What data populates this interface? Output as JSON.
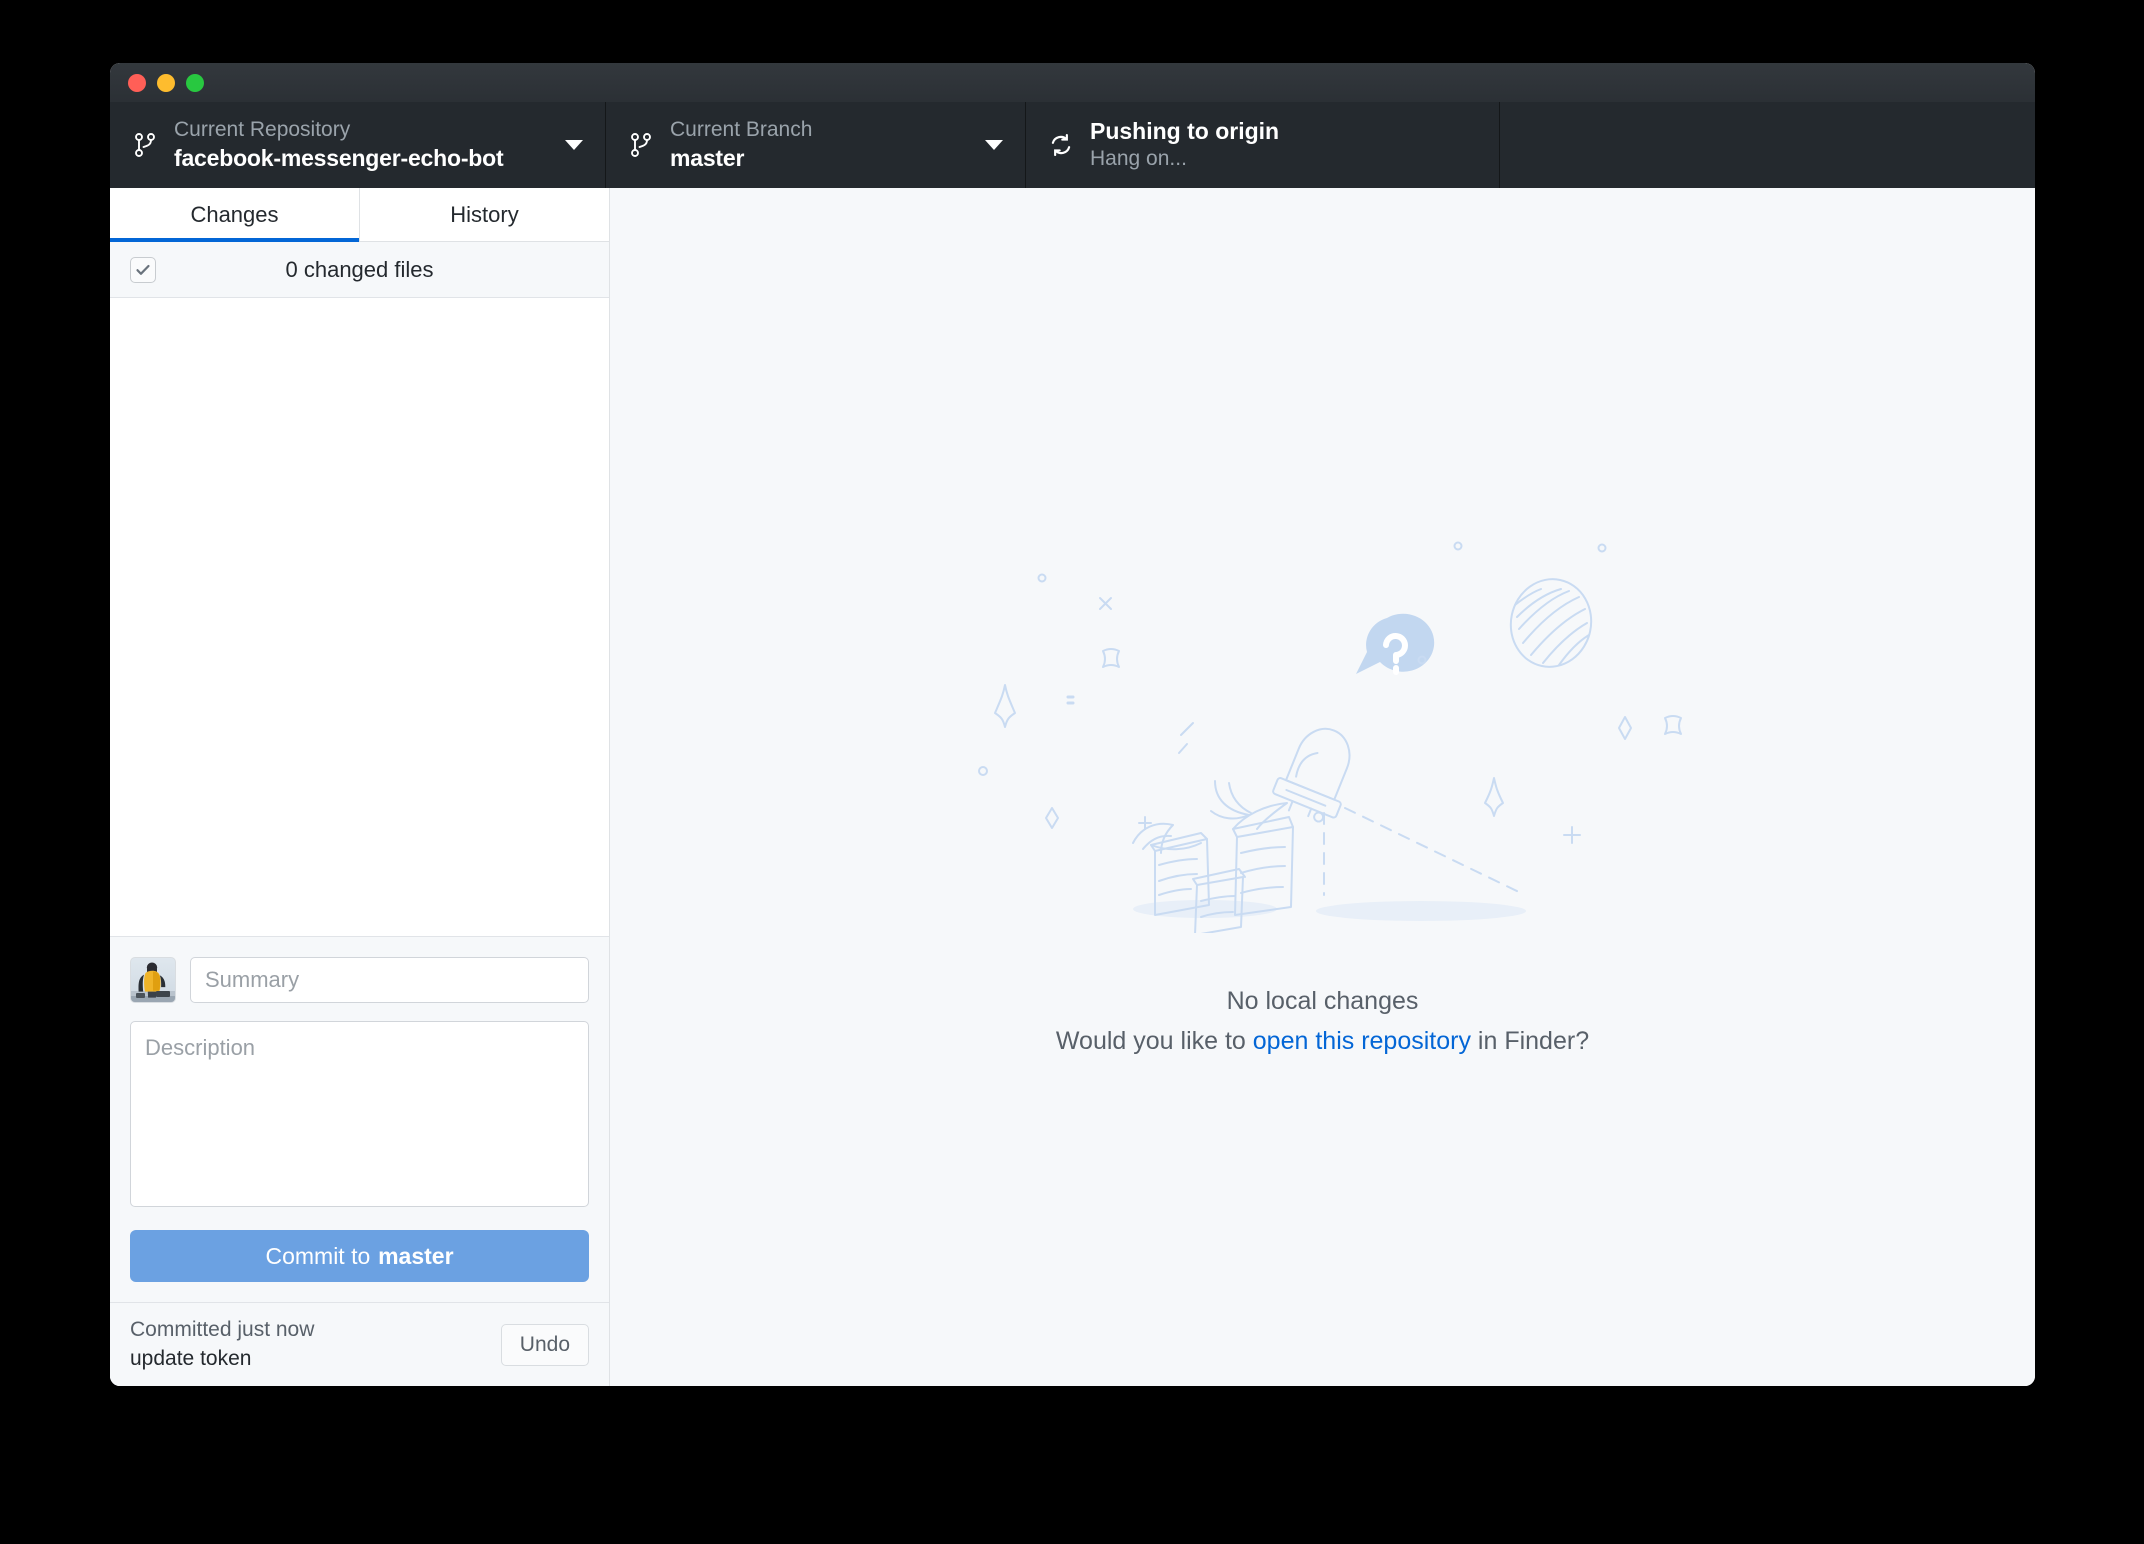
{
  "window": {
    "traffic_lights": [
      {
        "name": "close",
        "color": "#ff5f57"
      },
      {
        "name": "minimize",
        "color": "#febc2e"
      },
      {
        "name": "maximize",
        "color": "#28c840"
      }
    ]
  },
  "toolbar": {
    "repository": {
      "icon": "repo-branch-icon",
      "label": "Current Repository",
      "value": "facebook-messenger-echo-bot"
    },
    "branch": {
      "icon": "branch-icon",
      "label": "Current Branch",
      "value": "master"
    },
    "push": {
      "icon": "sync-icon",
      "title": "Pushing to origin",
      "subtitle": "Hang on..."
    }
  },
  "sidebar": {
    "tabs": [
      {
        "label": "Changes",
        "active": true
      },
      {
        "label": "History",
        "active": false
      }
    ],
    "changed_files": {
      "label": "0 changed files",
      "checkbox_state": "checked"
    },
    "commit_form": {
      "summary_placeholder": "Summary",
      "summary_value": "",
      "description_placeholder": "Description",
      "description_value": "",
      "commit_button_prefix": "Commit to",
      "commit_button_branch": "master"
    },
    "undo_bar": {
      "status": "Committed just now",
      "summary": "update token",
      "undo_label": "Undo"
    }
  },
  "main": {
    "empty_state": {
      "title": "No local changes",
      "sub_before": "Would you like to",
      "link": "open this repository",
      "sub_after": "in Finder?"
    }
  },
  "colors": {
    "toolbar_bg": "#24292e",
    "titlebar_bg": "#30353a",
    "accent_blue": "#0366d6",
    "commit_button": "#6ba1e2",
    "panel_bg": "#f6f8fa",
    "border": "#e1e4e8",
    "illustration_stroke": "#c9dbf2",
    "muted_text": "#586069"
  }
}
